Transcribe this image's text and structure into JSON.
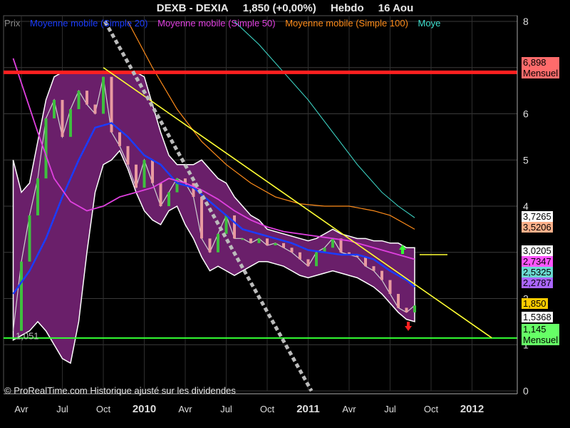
{
  "header": {
    "symbol": "DEXB - DEXIA",
    "price": "1,850 (+0,00%)",
    "period": "Hebdo",
    "date": "16 Aou"
  },
  "legend": [
    {
      "label": "Prix",
      "color": "#888888"
    },
    {
      "label": "Moyenne mobile (Simple 20)",
      "color": "#1a3cff"
    },
    {
      "label": "Moyenne mobile (Simple 50)",
      "color": "#e040e0"
    },
    {
      "label": "Moyenne mobile (Simple 100)",
      "color": "#ff8c1a"
    },
    {
      "label": "Moye",
      "color": "#40e0d0"
    }
  ],
  "credit": "© ProRealTime.com Historique ajusté sur les dividendes",
  "low_label": "1,051",
  "price_tags": [
    {
      "value": "6,898",
      "sub": "Mensuel",
      "bg": "#ff6b6b"
    },
    {
      "value": "3,7265",
      "bg": "#ffffff"
    },
    {
      "value": "3,5206",
      "bg": "#ffb08a"
    },
    {
      "value": "3,0205",
      "bg": "#ffffff"
    },
    {
      "value": "2,7347",
      "bg": "#ff55ff"
    },
    {
      "value": "2,5325",
      "bg": "#6ad9d0"
    },
    {
      "value": "2,2787",
      "bg": "#aa66ff"
    },
    {
      "value": "1,850",
      "bg": "#ffcc00"
    },
    {
      "value": "1,5368",
      "bg": "#ffffff"
    },
    {
      "value": "1,145",
      "sub": "Mensuel",
      "bg": "#66ff66"
    }
  ],
  "chart_data": {
    "type": "line",
    "title": "DEXB - DEXIA 1,850 (+0,00%) Hebdo 16 Aou",
    "y_ticks": [
      "0",
      "1",
      "2",
      "3",
      "4",
      "5",
      "6",
      "7",
      "8"
    ],
    "ylim": [
      0,
      8
    ],
    "x_ticks": [
      {
        "label": "Avr",
        "t": 0.0
      },
      {
        "label": "Jul",
        "t": 0.25
      },
      {
        "label": "Oct",
        "t": 0.5
      },
      {
        "label": "2010",
        "t": 0.75
      },
      {
        "label": "Avr",
        "t": 1.0
      },
      {
        "label": "Jul",
        "t": 1.25
      },
      {
        "label": "Oct",
        "t": 1.5
      },
      {
        "label": "2011",
        "t": 1.75
      },
      {
        "label": "Avr",
        "t": 2.0
      },
      {
        "label": "Jul",
        "t": 2.25
      },
      {
        "label": "Oct",
        "t": 2.5
      },
      {
        "label": "2012",
        "t": 2.75
      }
    ],
    "grid": true,
    "horizontal_lines": [
      {
        "name": "Mensuel",
        "value": 6.898,
        "color": "#ff2020"
      },
      {
        "name": "Mensuel",
        "value": 1.145,
        "color": "#33ff33"
      }
    ],
    "trendlines": [
      {
        "color": "#ffff33",
        "from": [
          0.5,
          7.0
        ],
        "to": [
          2.87,
          1.15
        ]
      },
      {
        "color": "#ffff33",
        "from": [
          2.43,
          2.95
        ],
        "to": [
          2.6,
          2.95
        ]
      },
      {
        "color": "#bbbbbb",
        "from": [
          0.51,
          8.0
        ],
        "to": [
          1.77,
          0.0
        ],
        "dashed": true
      }
    ],
    "series": [
      {
        "name": "Prix",
        "color": "#d0d0d0",
        "x": [
          -0.05,
          0.0,
          0.05,
          0.1,
          0.15,
          0.2,
          0.25,
          0.3,
          0.35,
          0.4,
          0.45,
          0.5,
          0.55,
          0.6,
          0.65,
          0.7,
          0.75,
          0.8,
          0.85,
          0.9,
          0.95,
          1.0,
          1.05,
          1.1,
          1.15,
          1.2,
          1.25,
          1.3,
          1.35,
          1.4,
          1.45,
          1.5,
          1.55,
          1.6,
          1.65,
          1.7,
          1.75,
          1.8,
          1.85,
          1.9,
          1.95,
          2.0,
          2.05,
          2.1,
          2.15,
          2.2,
          2.25,
          2.3,
          2.35,
          2.4
        ],
        "y": [
          1.3,
          2.8,
          3.8,
          4.6,
          5.9,
          6.3,
          5.5,
          6.1,
          6.5,
          6.2,
          6.0,
          6.8,
          5.6,
          5.3,
          4.9,
          4.4,
          5.0,
          4.5,
          4.0,
          4.3,
          4.6,
          4.5,
          4.2,
          3.3,
          3.0,
          3.4,
          3.8,
          3.3,
          3.3,
          3.2,
          3.3,
          3.15,
          3.2,
          3.1,
          3.0,
          2.85,
          2.7,
          3.0,
          3.1,
          3.3,
          3.0,
          2.95,
          2.9,
          2.7,
          2.6,
          2.4,
          2.1,
          1.8,
          1.7,
          1.85
        ]
      },
      {
        "name": "Moyenne mobile (Simple 20)",
        "color": "#1a3cff",
        "x": [
          -0.05,
          0.05,
          0.15,
          0.25,
          0.35,
          0.45,
          0.55,
          0.65,
          0.75,
          0.85,
          0.95,
          1.05,
          1.15,
          1.25,
          1.35,
          1.45,
          1.55,
          1.65,
          1.75,
          1.85,
          1.95,
          2.05,
          2.15,
          2.25,
          2.35,
          2.4
        ],
        "y": [
          2.1,
          2.6,
          3.3,
          4.2,
          5.0,
          5.7,
          5.8,
          5.5,
          5.1,
          4.9,
          4.5,
          4.4,
          4.1,
          3.8,
          3.5,
          3.4,
          3.3,
          3.2,
          3.05,
          3.0,
          2.95,
          2.95,
          2.85,
          2.6,
          2.4,
          2.25
        ]
      },
      {
        "name": "Moyenne mobile (Simple 50)",
        "color": "#e040e0",
        "x": [
          -0.05,
          0.1,
          0.2,
          0.3,
          0.4,
          0.5,
          0.6,
          0.7,
          0.8,
          0.9,
          1.0,
          1.1,
          1.2,
          1.3,
          1.4,
          1.5,
          1.6,
          1.7,
          1.8,
          1.9,
          2.0,
          2.1,
          2.2,
          2.3,
          2.4
        ],
        "y": [
          7.2,
          5.6,
          4.6,
          4.1,
          3.9,
          4.0,
          4.2,
          4.3,
          4.4,
          4.6,
          4.5,
          4.35,
          4.15,
          3.9,
          3.7,
          3.55,
          3.45,
          3.4,
          3.35,
          3.3,
          3.25,
          3.15,
          3.05,
          2.95,
          2.85
        ]
      },
      {
        "name": "Moyenne mobile (Simple 100)",
        "color": "#ff8c1a",
        "x": [
          0.65,
          0.8,
          0.95,
          1.1,
          1.25,
          1.4,
          1.55,
          1.7,
          1.85,
          2.0,
          2.15,
          2.25,
          2.35,
          2.4
        ],
        "y": [
          8.0,
          7.0,
          6.1,
          5.4,
          4.9,
          4.5,
          4.2,
          4.05,
          4.0,
          4.0,
          3.9,
          3.8,
          3.6,
          3.5
        ]
      },
      {
        "name": "Moye",
        "color": "#40e0d0",
        "x": [
          1.3,
          1.45,
          1.6,
          1.75,
          1.9,
          2.05,
          2.2,
          2.3,
          2.4
        ],
        "y": [
          8.0,
          7.5,
          6.9,
          6.3,
          5.6,
          4.9,
          4.3,
          4.0,
          3.75
        ]
      }
    ],
    "bands": [
      {
        "name": "Bollinger",
        "color": "#6a1f6a",
        "x": [
          -0.05,
          0.0,
          0.05,
          0.1,
          0.15,
          0.2,
          0.25,
          0.3,
          0.35,
          0.4,
          0.45,
          0.5,
          0.55,
          0.6,
          0.65,
          0.7,
          0.75,
          0.8,
          0.85,
          0.9,
          0.95,
          1.0,
          1.05,
          1.1,
          1.15,
          1.2,
          1.25,
          1.3,
          1.35,
          1.4,
          1.45,
          1.5,
          1.55,
          1.6,
          1.65,
          1.7,
          1.75,
          1.8,
          1.85,
          1.9,
          1.95,
          2.0,
          2.05,
          2.1,
          2.15,
          2.2,
          2.25,
          2.3,
          2.35,
          2.4
        ],
        "upper": [
          5.0,
          4.3,
          4.5,
          5.4,
          6.3,
          6.8,
          6.9,
          6.9,
          6.9,
          6.9,
          6.9,
          6.9,
          6.9,
          6.9,
          6.9,
          6.9,
          6.8,
          6.2,
          5.6,
          5.1,
          4.9,
          4.9,
          4.9,
          5.0,
          4.8,
          4.6,
          4.5,
          4.2,
          4.0,
          3.8,
          3.7,
          3.5,
          3.45,
          3.4,
          3.35,
          3.3,
          3.25,
          3.3,
          3.4,
          3.5,
          3.4,
          3.35,
          3.3,
          3.3,
          3.25,
          3.25,
          3.2,
          3.2,
          3.1,
          3.1
        ],
        "lower": [
          1.1,
          1.2,
          1.3,
          1.5,
          1.3,
          1.0,
          0.7,
          0.6,
          1.5,
          3.0,
          4.3,
          4.9,
          5.0,
          5.2,
          4.8,
          4.3,
          3.9,
          3.7,
          3.6,
          3.9,
          4.0,
          3.6,
          3.3,
          2.9,
          2.6,
          2.7,
          2.6,
          2.5,
          2.6,
          2.7,
          2.8,
          2.8,
          2.75,
          2.7,
          2.6,
          2.5,
          2.45,
          2.5,
          2.55,
          2.6,
          2.55,
          2.5,
          2.45,
          2.35,
          2.25,
          2.1,
          1.9,
          1.7,
          1.55,
          1.5
        ]
      }
    ]
  }
}
